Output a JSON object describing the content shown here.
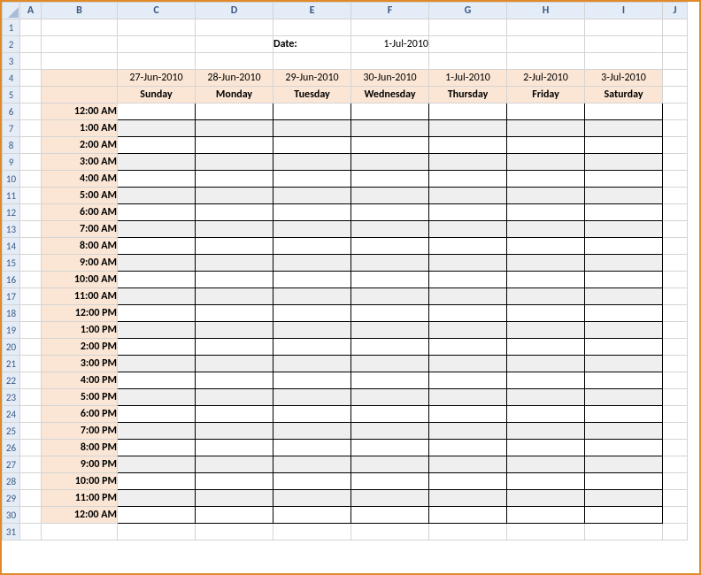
{
  "columns": [
    "A",
    "B",
    "C",
    "D",
    "E",
    "F",
    "G",
    "H",
    "I",
    "J"
  ],
  "header": {
    "date_label": "Date:",
    "date_value": "1-Jul-2010"
  },
  "days": {
    "dates": [
      "27-Jun-2010",
      "28-Jun-2010",
      "29-Jun-2010",
      "30-Jun-2010",
      "1-Jul-2010",
      "2-Jul-2010",
      "3-Jul-2010"
    ],
    "names": [
      "Sunday",
      "Monday",
      "Tuesday",
      "Wednesday",
      "Thursday",
      "Friday",
      "Saturday"
    ]
  },
  "times": [
    "12:00 AM",
    "1:00 AM",
    "2:00 AM",
    "3:00 AM",
    "4:00 AM",
    "5:00 AM",
    "6:00 AM",
    "7:00 AM",
    "8:00 AM",
    "9:00 AM",
    "10:00 AM",
    "11:00 AM",
    "12:00 PM",
    "1:00 PM",
    "2:00 PM",
    "3:00 PM",
    "4:00 PM",
    "5:00 PM",
    "6:00 PM",
    "7:00 PM",
    "8:00 PM",
    "9:00 PM",
    "10:00 PM",
    "11:00 PM",
    "12:00 AM"
  ],
  "rows_total": 31
}
